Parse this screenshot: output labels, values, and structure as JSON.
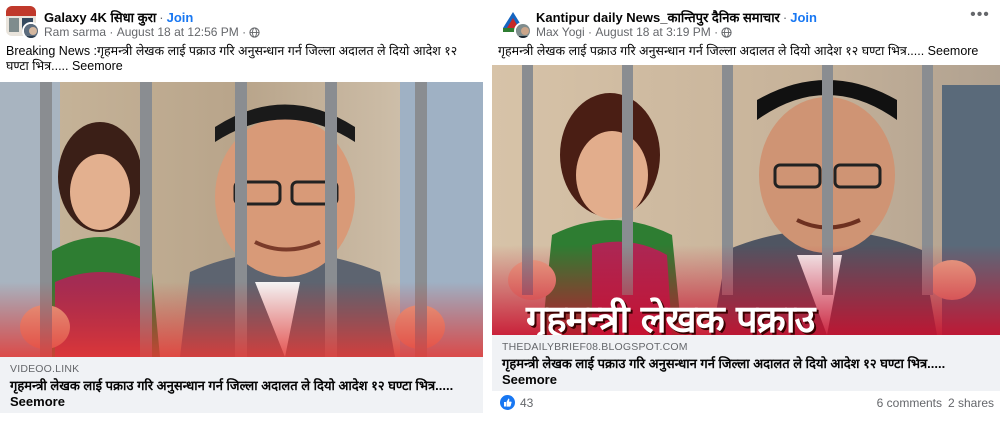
{
  "posts": [
    {
      "group_name": "Galaxy 4K सिधा कुरा",
      "join_label": "Join",
      "author": "Ram sarma",
      "date": "August 18 at 12:56 PM",
      "text": "Breaking News :गृहमन्त्री लेखक लाई पक्राउ गरि अनुसन्धान गर्न जिल्ला अदालत ले दियो आदेश १२ घण्टा भित्र..... Seemore",
      "link_domain": "VIDEOO.LINK",
      "link_title": "गृहमन्त्री लेखक लाई पक्राउ गरि अनुसन्धान गर्न जिल्ला अदालत ले दियो आदेश १२ घण्टा भित्र..... Seemore"
    },
    {
      "group_name": "Kantipur daily News_कान्तिपुर दैनिक समाचार",
      "join_label": "Join",
      "author": "Max Yogi",
      "date": "August 18 at 3:19 PM",
      "text": "गृहमन्त्री लेखक लाई पक्राउ गरि अनुसन्धान गर्न जिल्ला अदालत ले दियो आदेश १२ घण्टा भित्र..... Seemore",
      "image_headline": "गृहमन्त्री लेखक पक्राउ",
      "link_domain": "THEDAILYBRIEF08.BLOGSPOT.COM",
      "link_title": "गृहमन्त्री लेखक लाई पक्राउ गरि अनुसन्धान गर्न जिल्ला अदालत ले दियो आदेश १२ घण्टा भित्र..... Seemore",
      "likes": "43",
      "comments": "6 comments",
      "shares": "2 shares"
    }
  ],
  "icons": {
    "globe": "globe-icon",
    "more": "more-options-icon",
    "like": "like-icon",
    "info": "info-icon"
  },
  "colors": {
    "link": "#1877f2",
    "muted": "#65676b",
    "link_box_bg": "#f0f2f5",
    "banner": "#c8102e"
  }
}
